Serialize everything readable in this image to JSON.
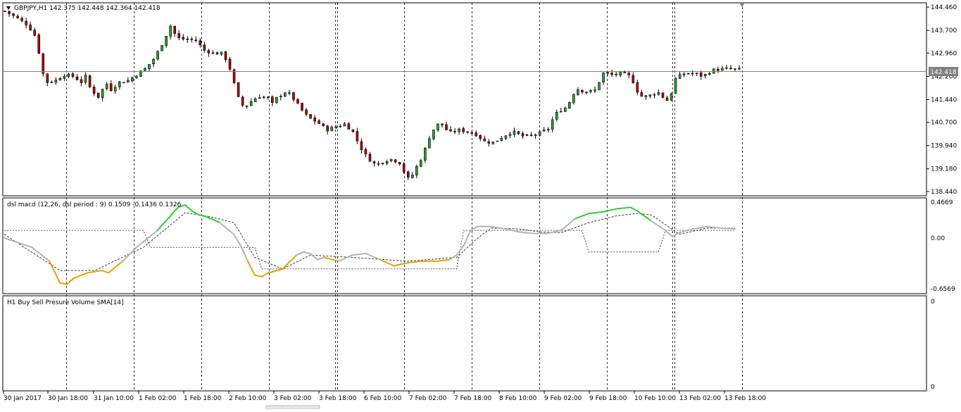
{
  "chart_data": [
    {
      "type": "candlestick",
      "title": "GBPJPY,H1  142.375 142.448 142.364 142.418",
      "ylim": [
        138.3,
        144.6
      ],
      "y_ticks": [
        "144.460",
        "143.700",
        "142.960",
        "142.200",
        "141.440",
        "140.700",
        "139.940",
        "139.180",
        "138.440"
      ],
      "current_price": "142.418",
      "x_labels": [
        "30 Jan 2017",
        "30 Jan 18:00",
        "31 Jan 10:00",
        "1 Feb 02:00",
        "1 Feb 18:00",
        "2 Feb 10:00",
        "3 Feb 02:00",
        "3 Feb 18:00",
        "6 Feb 10:00",
        "7 Feb 02:00",
        "7 Feb 18:00",
        "8 Feb 10:00",
        "9 Feb 02:00",
        "9 Feb 18:00",
        "10 Feb 10:00",
        "13 Feb 02:00",
        "13 Feb 18:00"
      ],
      "bar_count": 174,
      "close_path": [
        [
          0,
          144.33
        ],
        [
          5,
          144.12
        ],
        [
          10,
          143.88
        ],
        [
          14,
          143.45
        ],
        [
          16,
          142.5
        ],
        [
          18,
          142.0
        ],
        [
          22,
          142.05
        ],
        [
          26,
          142.25
        ],
        [
          30,
          142.2
        ],
        [
          34,
          142.0
        ],
        [
          36,
          142.25
        ],
        [
          38,
          141.7
        ],
        [
          40,
          141.65
        ],
        [
          42,
          141.45
        ],
        [
          44,
          142.05
        ],
        [
          47,
          141.75
        ],
        [
          50,
          142.0
        ],
        [
          54,
          142.05
        ],
        [
          58,
          142.25
        ],
        [
          62,
          142.45
        ],
        [
          66,
          142.8
        ],
        [
          70,
          143.35
        ],
        [
          73,
          143.85
        ],
        [
          76,
          143.45
        ],
        [
          80,
          143.4
        ],
        [
          84,
          143.4
        ],
        [
          88,
          143.05
        ],
        [
          92,
          142.95
        ],
        [
          96,
          142.95
        ],
        [
          98,
          142.7
        ],
        [
          100,
          142.3
        ],
        [
          102,
          141.7
        ],
        [
          104,
          141.3
        ],
        [
          106,
          141.2
        ],
        [
          108,
          141.35
        ],
        [
          112,
          141.55
        ],
        [
          116,
          141.5
        ],
        [
          118,
          141.3
        ],
        [
          120,
          141.5
        ],
        [
          124,
          141.7
        ],
        [
          126,
          141.6
        ],
        [
          128,
          141.4
        ],
        [
          130,
          141.2
        ],
        [
          132,
          141.0
        ],
        [
          134,
          140.85
        ],
        [
          138,
          140.7
        ],
        [
          142,
          140.45
        ],
        [
          146,
          140.55
        ],
        [
          150,
          140.65
        ],
        [
          154,
          140.35
        ],
        [
          156,
          140.0
        ],
        [
          158,
          139.75
        ],
        [
          160,
          139.55
        ],
        [
          162,
          139.4
        ],
        [
          164,
          139.3
        ],
        [
          166,
          139.4
        ],
        [
          170,
          139.5
        ],
        [
          174,
          139.4
        ],
        [
          176,
          139.1
        ],
        [
          178,
          138.85
        ],
        [
          180,
          139.0
        ],
        [
          182,
          139.3
        ],
        [
          184,
          139.55
        ],
        [
          186,
          139.95
        ],
        [
          188,
          140.35
        ],
        [
          190,
          140.55
        ],
        [
          192,
          140.7
        ],
        [
          196,
          140.35
        ],
        [
          200,
          140.45
        ],
        [
          204,
          140.4
        ],
        [
          208,
          140.3
        ],
        [
          212,
          140.05
        ],
        [
          216,
          140.05
        ],
        [
          220,
          140.25
        ],
        [
          224,
          140.4
        ],
        [
          228,
          140.25
        ],
        [
          232,
          140.25
        ],
        [
          236,
          140.35
        ],
        [
          240,
          140.5
        ],
        [
          242,
          140.85
        ],
        [
          244,
          141.05
        ],
        [
          248,
          141.2
        ],
        [
          250,
          141.5
        ],
        [
          252,
          141.8
        ],
        [
          256,
          141.7
        ],
        [
          260,
          141.7
        ],
        [
          264,
          142.3
        ],
        [
          268,
          142.25
        ],
        [
          272,
          142.3
        ],
        [
          276,
          142.2
        ],
        [
          278,
          141.9
        ],
        [
          280,
          141.55
        ],
        [
          284,
          141.55
        ],
        [
          288,
          141.7
        ],
        [
          292,
          141.4
        ],
        [
          294,
          141.65
        ],
        [
          296,
          142.15
        ],
        [
          300,
          142.3
        ],
        [
          304,
          142.3
        ],
        [
          308,
          142.2
        ],
        [
          312,
          142.4
        ],
        [
          318,
          142.45
        ],
        [
          324,
          142.42
        ]
      ]
    },
    {
      "type": "line",
      "title": "dsl macd (12,26, dsl period : 9) 0.1509 -0.1436 0.1326",
      "ylim": [
        -0.6569,
        0.4669
      ],
      "y_ticks": [
        "0.4669",
        "0.00",
        "-0.6569"
      ],
      "series": [
        {
          "values": [
            [
              0,
              0
            ],
            [
              8,
              -0.12
            ],
            [
              13,
              -0.3
            ],
            [
              16,
              -0.58
            ],
            [
              18,
              -0.6
            ],
            [
              20,
              -0.52
            ],
            [
              24,
              -0.45
            ],
            [
              28,
              -0.42
            ],
            [
              30,
              -0.45
            ],
            [
              34,
              -0.3
            ],
            [
              38,
              -0.12
            ],
            [
              40,
              -0.05
            ],
            [
              44,
              0.1
            ],
            [
              48,
              0.3
            ],
            [
              50,
              0.4
            ],
            [
              52,
              0.43
            ],
            [
              54,
              0.35
            ],
            [
              56,
              0.3
            ],
            [
              58,
              0.28
            ],
            [
              62,
              0.2
            ],
            [
              66,
              0.05
            ],
            [
              68,
              -0.1
            ],
            [
              70,
              -0.3
            ],
            [
              72,
              -0.48
            ],
            [
              74,
              -0.5
            ],
            [
              76,
              -0.45
            ],
            [
              80,
              -0.4
            ],
            [
              84,
              -0.22
            ],
            [
              86,
              -0.18
            ],
            [
              88,
              -0.2
            ],
            [
              90,
              -0.28
            ],
            [
              92,
              -0.25
            ],
            [
              96,
              -0.3
            ],
            [
              100,
              -0.22
            ],
            [
              104,
              -0.2
            ],
            [
              108,
              -0.28
            ],
            [
              112,
              -0.36
            ],
            [
              116,
              -0.32
            ],
            [
              120,
              -0.3
            ],
            [
              124,
              -0.3
            ],
            [
              128,
              -0.28
            ],
            [
              130,
              -0.22
            ],
            [
              132,
              -0.1
            ],
            [
              134,
              0.1
            ],
            [
              136,
              0.15
            ],
            [
              140,
              0.15
            ],
            [
              144,
              0.12
            ],
            [
              148,
              0.08
            ],
            [
              152,
              0.06
            ],
            [
              156,
              0.06
            ],
            [
              160,
              0.1
            ],
            [
              164,
              0.25
            ],
            [
              168,
              0.32
            ],
            [
              172,
              0.34
            ],
            [
              176,
              0.38
            ],
            [
              180,
              0.4
            ],
            [
              182,
              0.35
            ],
            [
              186,
              0.22
            ],
            [
              190,
              0.1
            ],
            [
              192,
              0.02
            ],
            [
              194,
              0.07
            ],
            [
              198,
              0.12
            ],
            [
              202,
              0.15
            ],
            [
              206,
              0.13
            ],
            [
              210,
              0.12
            ]
          ]
        },
        {
          "values": [
            [
              0,
              0.05
            ],
            [
              16,
              -0.42
            ],
            [
              26,
              -0.42
            ],
            [
              40,
              -0.12
            ],
            [
              52,
              0.33
            ],
            [
              60,
              0.27
            ],
            [
              66,
              0.2
            ],
            [
              72,
              -0.25
            ],
            [
              80,
              -0.4
            ],
            [
              88,
              -0.22
            ],
            [
              100,
              -0.25
            ],
            [
              116,
              -0.3
            ],
            [
              130,
              -0.25
            ],
            [
              136,
              0.0
            ],
            [
              140,
              0.13
            ],
            [
              148,
              0.12
            ],
            [
              154,
              0.08
            ],
            [
              160,
              0.07
            ],
            [
              168,
              0.2
            ],
            [
              176,
              0.29
            ],
            [
              182,
              0.32
            ],
            [
              186,
              0.3
            ],
            [
              194,
              0.05
            ],
            [
              202,
              0.13
            ],
            [
              210,
              0.13
            ]
          ]
        },
        {
          "values": [
            [
              0,
              0.1
            ],
            [
              4,
              0.1
            ],
            [
              40,
              0.1
            ],
            [
              42,
              -0.12
            ],
            [
              72,
              -0.12
            ],
            [
              74,
              -0.4
            ],
            [
              130,
              -0.4
            ],
            [
              132,
              0.1
            ],
            [
              166,
              0.1
            ],
            [
              168,
              -0.18
            ],
            [
              188,
              -0.18
            ],
            [
              190,
              0.1
            ],
            [
              210,
              0.1
            ]
          ]
        }
      ]
    },
    {
      "type": "bar",
      "title": "H1  Buy Sell Presure Volume SMA[14]",
      "y_ticks": [
        "0",
        "0"
      ],
      "values": []
    }
  ]
}
